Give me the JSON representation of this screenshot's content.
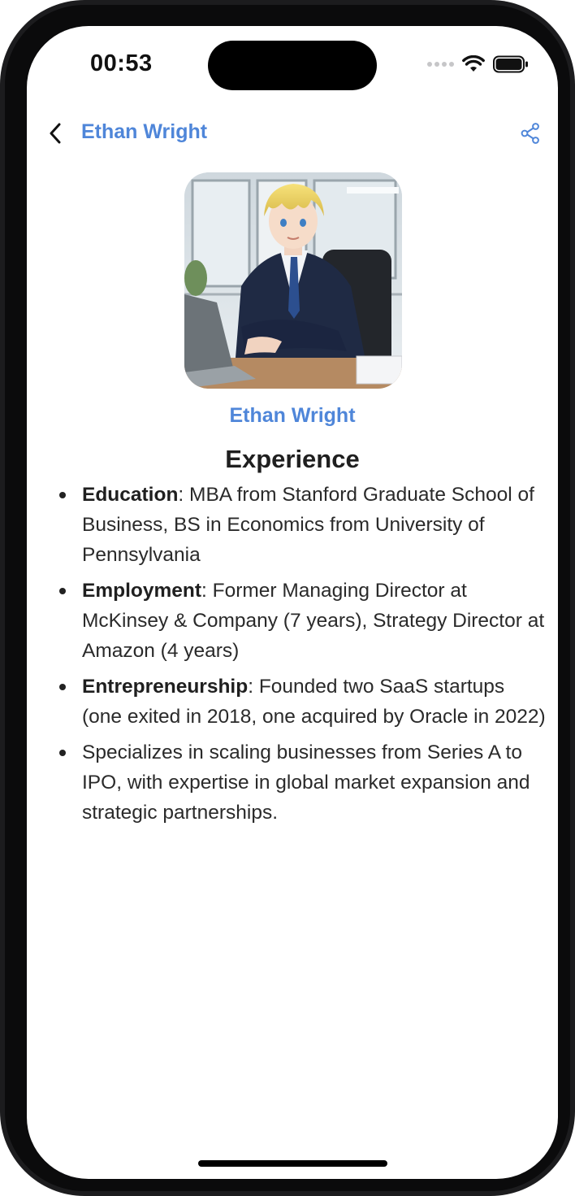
{
  "status_bar": {
    "time": "00:53",
    "icons": [
      "cellular-dots-icon",
      "wifi-icon",
      "battery-icon"
    ]
  },
  "nav": {
    "title": "Ethan Wright",
    "back_icon": "chevron-left-icon",
    "share_icon": "share-icon"
  },
  "profile": {
    "avatar": "profile-photo-businessman-at-desk",
    "name": "Ethan Wright"
  },
  "experience": {
    "title": "Experience",
    "items": [
      {
        "label": "Education",
        "text": ": MBA from Stanford Graduate School of Business, BS in Economics from University of Pennsylvania"
      },
      {
        "label": "Employment",
        "text": ": Former Managing Director at McKinsey & Company (7 years), Strategy Director at Amazon (4 years)"
      },
      {
        "label": "Entrepreneurship",
        "text": ": Founded two SaaS startups (one exited in 2018, one acquired by Oracle in 2022)"
      },
      {
        "label": "",
        "text": "Specializes in scaling businesses from Series A to IPO, with expertise in global market expansion and strategic partnerships."
      }
    ]
  },
  "colors": {
    "accent": "#4f86d9",
    "text": "#1f1f1f",
    "background": "#ffffff"
  }
}
